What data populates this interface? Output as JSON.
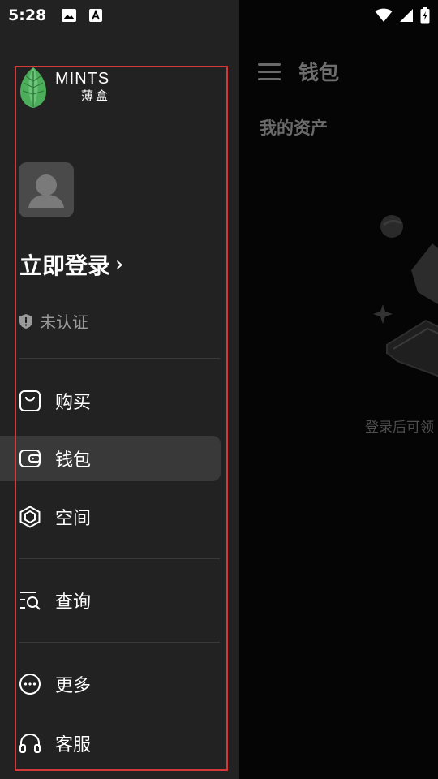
{
  "status_bar": {
    "time": "5:28",
    "icons": [
      "image-icon",
      "text-a-icon",
      "wifi-icon",
      "signal-icon",
      "battery-charging-icon"
    ]
  },
  "drawer": {
    "logo": {
      "en": "MINTS",
      "cn": "薄盒"
    },
    "login_label": "立即登录",
    "verify_label": "未认证",
    "menu": [
      {
        "label": "购买",
        "icon": "bag-icon",
        "active": false
      },
      {
        "label": "钱包",
        "icon": "wallet-icon",
        "active": true
      },
      {
        "label": "空间",
        "icon": "hexagon-space-icon",
        "active": false
      },
      {
        "label": "查询",
        "icon": "search-list-icon",
        "active": false
      },
      {
        "label": "更多",
        "icon": "more-dots-icon",
        "active": false
      },
      {
        "label": "客服",
        "icon": "headphones-icon",
        "active": false
      }
    ]
  },
  "main": {
    "title": "钱包",
    "section_title": "我的资产",
    "empty_text": "登录后可领"
  },
  "colors": {
    "drawer_bg": "#222222",
    "frame": "#d23a3a",
    "active_bg": "#393939"
  }
}
